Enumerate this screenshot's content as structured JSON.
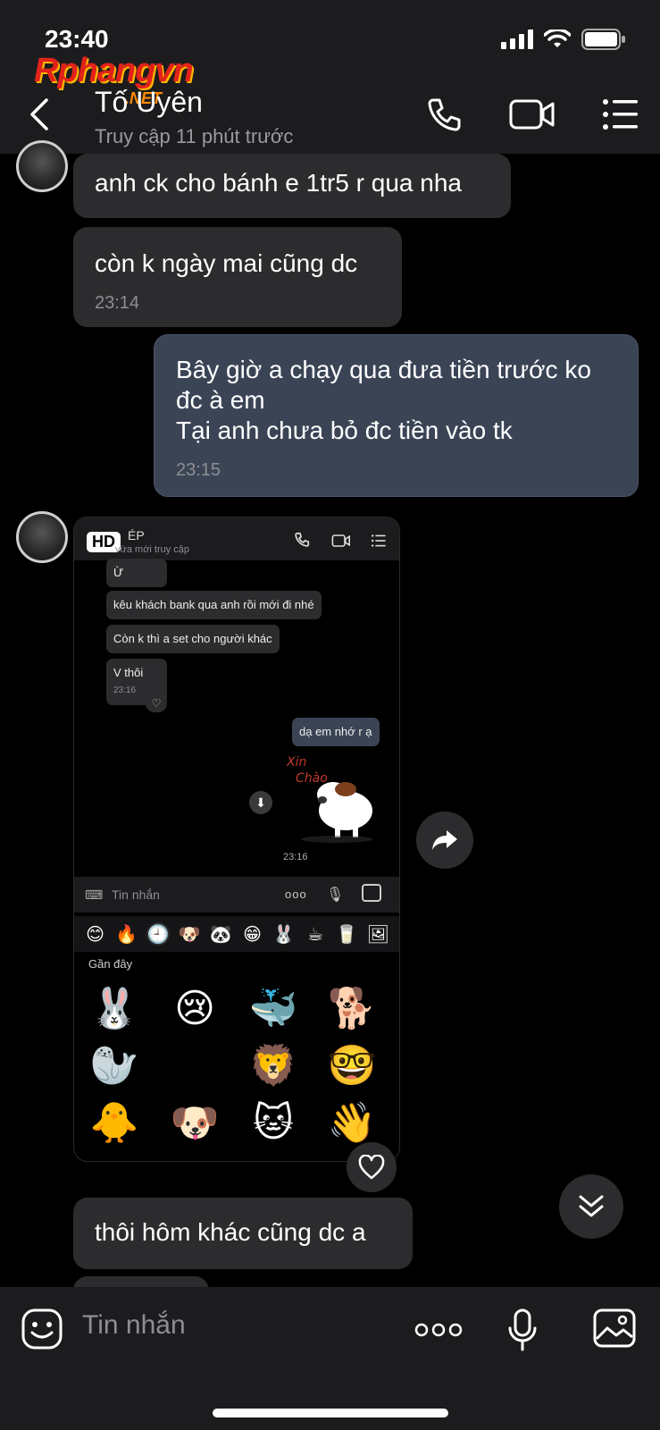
{
  "status_bar": {
    "time": "23:40"
  },
  "watermark": {
    "main": "Rphangvn",
    "suffix": ".NET"
  },
  "header": {
    "contact_name": "Tố Uyên",
    "last_seen": "Truy cập 11 phút trước"
  },
  "messages": [
    {
      "direction": "in",
      "text": "anh ck cho bánh e 1tr5 r qua nha"
    },
    {
      "direction": "in",
      "text": "còn k ngày mai cũng dc",
      "time": "23:14"
    },
    {
      "direction": "out",
      "lines": [
        "Bây giờ a chạy qua đưa tiền trước ko",
        "đc à em",
        "Tại anh chưa bỏ đc tiền vào tk"
      ],
      "time": "23:15"
    },
    {
      "direction": "in",
      "text": "thôi hôm khác cũng dc a"
    }
  ],
  "image_message": {
    "hd_badge": "HD",
    "inner_header": {
      "name": "ÉP",
      "status": "vừa mới truy cập"
    },
    "inner_messages": [
      {
        "direction": "in",
        "text": "Ừ"
      },
      {
        "direction": "in",
        "text": "kêu khách bank qua anh rồi mới đi nhé"
      },
      {
        "direction": "in",
        "text": "Còn k thì a set cho người khác"
      },
      {
        "direction": "in",
        "text": "V thôi",
        "time": "23:16"
      },
      {
        "direction": "out",
        "text": "dạ em nhớ r ạ"
      }
    ],
    "sticker_time": "23:16",
    "input_placeholder": "Tin nhắn",
    "recent_label": "Gần đây",
    "emoji_tabs": [
      "😊",
      "🔥",
      "🕘",
      "🐶",
      "🐼",
      "😁",
      "🐰",
      "☕",
      "🥛",
      "🖼"
    ],
    "stickers": [
      "🐰",
      "😢",
      "🐳",
      "🐕",
      "🦭",
      "",
      "🦁",
      "🤓",
      "🐥",
      "🐶",
      "🐱",
      "👋"
    ]
  },
  "bottom_bar": {
    "placeholder": "Tin nhắn"
  },
  "colors": {
    "background": "#000000",
    "bubble_in": "#2c2c2e",
    "bubble_out": "#3a4455",
    "header": "#1c1c1e"
  }
}
